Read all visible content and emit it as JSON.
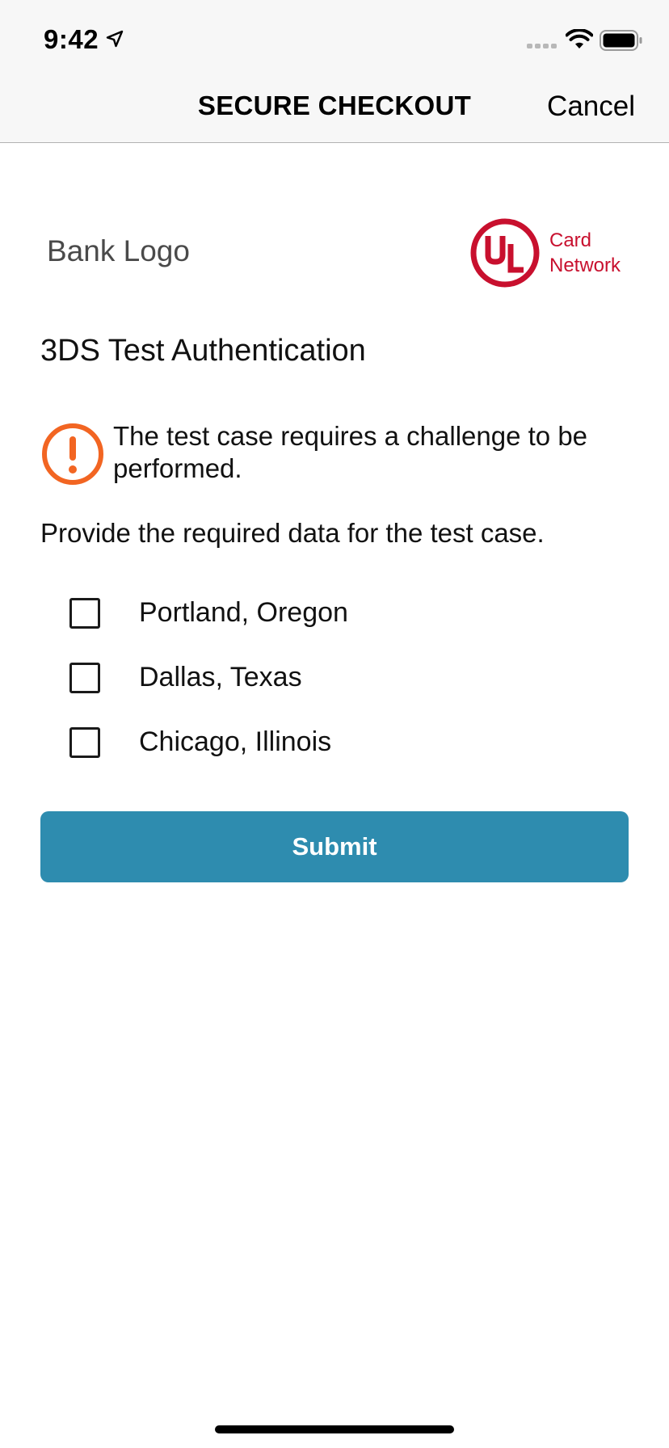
{
  "status_bar": {
    "time": "9:42",
    "icons": [
      "location-arrow-icon",
      "signal-icon",
      "wifi-icon",
      "battery-icon"
    ]
  },
  "nav": {
    "title": "SECURE CHECKOUT",
    "cancel_label": "Cancel"
  },
  "logos": {
    "bank_logo_text": "Bank Logo",
    "network_mark": "UL",
    "network_text_line1": "Card",
    "network_text_line2": "Network",
    "network_color": "#c8102e"
  },
  "content": {
    "heading": "3DS Test Authentication",
    "warning_text": "The test case requires a challenge to be performed.",
    "warning_icon": "exclamation-circle-icon",
    "warning_color": "#f26522",
    "instruction": "Provide the required data for the test case.",
    "options": [
      {
        "label": "Portland, Oregon",
        "checked": false
      },
      {
        "label": "Dallas, Texas",
        "checked": false
      },
      {
        "label": "Chicago, Illinois",
        "checked": false
      }
    ],
    "submit_label": "Submit",
    "submit_color": "#2e8caf"
  }
}
